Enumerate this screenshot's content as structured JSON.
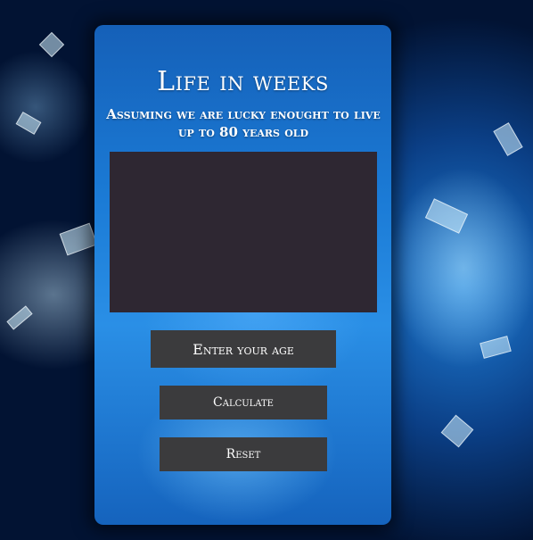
{
  "header": {
    "title": "Life in weeks",
    "subtitle": "Assuming we are lucky enought to live up to 80 years old"
  },
  "form": {
    "age_placeholder": "Enter your age",
    "age_value": "",
    "calculate_label": "Calculate",
    "reset_label": "Reset"
  },
  "colors": {
    "button_bg": "#3b3b3d",
    "grid_bg": "#2e2732",
    "text": "#ffffff"
  }
}
